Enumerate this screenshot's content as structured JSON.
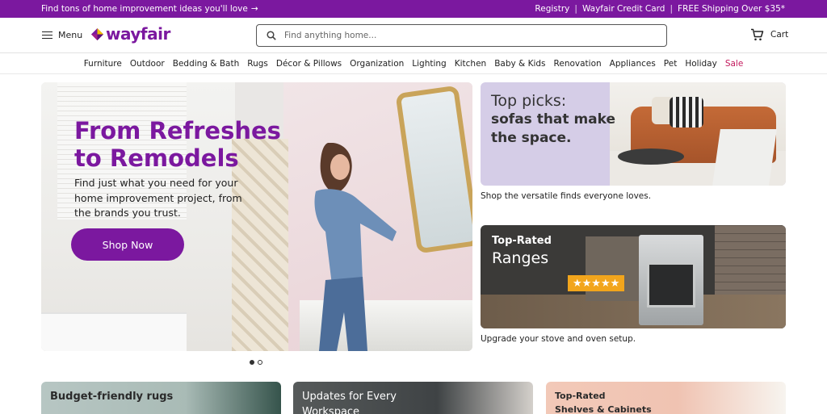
{
  "topbar": {
    "promo": "Find tons of home improvement ideas you'll love",
    "links": [
      "Registry",
      "Wayfair Credit Card",
      "FREE Shipping Over $35*"
    ]
  },
  "header": {
    "menu_label": "Menu",
    "logo_text": "wayfair",
    "search_placeholder": "Find anything home...",
    "cart_label": "Cart"
  },
  "categories": [
    "Furniture",
    "Outdoor",
    "Bedding & Bath",
    "Rugs",
    "Décor & Pillows",
    "Organization",
    "Lighting",
    "Kitchen",
    "Baby & Kids",
    "Renovation",
    "Appliances",
    "Pet",
    "Holiday",
    "Sale"
  ],
  "hero": {
    "title_line1": "From Refreshes",
    "title_line2": "to Remodels",
    "subtitle": "Find just what you need for your home improvement project, from the brands you trust.",
    "button": "Shop Now",
    "slides": 2,
    "active_slide": 1
  },
  "cards": [
    {
      "title_line1": "Top picks:",
      "title_line2": "sofas that make the space.",
      "caption": "Shop the versatile finds everyone loves."
    },
    {
      "title_line1": "Top-Rated",
      "title_line2": "Ranges",
      "rating_stars": "★★★★★",
      "caption": "Upgrade your stove and oven setup."
    }
  ],
  "tiles": [
    {
      "line1": "Budget-friendly rugs",
      "line2": ""
    },
    {
      "line1": "Updates for Every",
      "line2": "Workspace"
    },
    {
      "line1": "Top-Rated",
      "line2": "Shelves & Cabinets"
    }
  ],
  "colors": {
    "brand": "#7b189f",
    "sale": "#c2185b",
    "star_badge": "#f2a51c"
  }
}
